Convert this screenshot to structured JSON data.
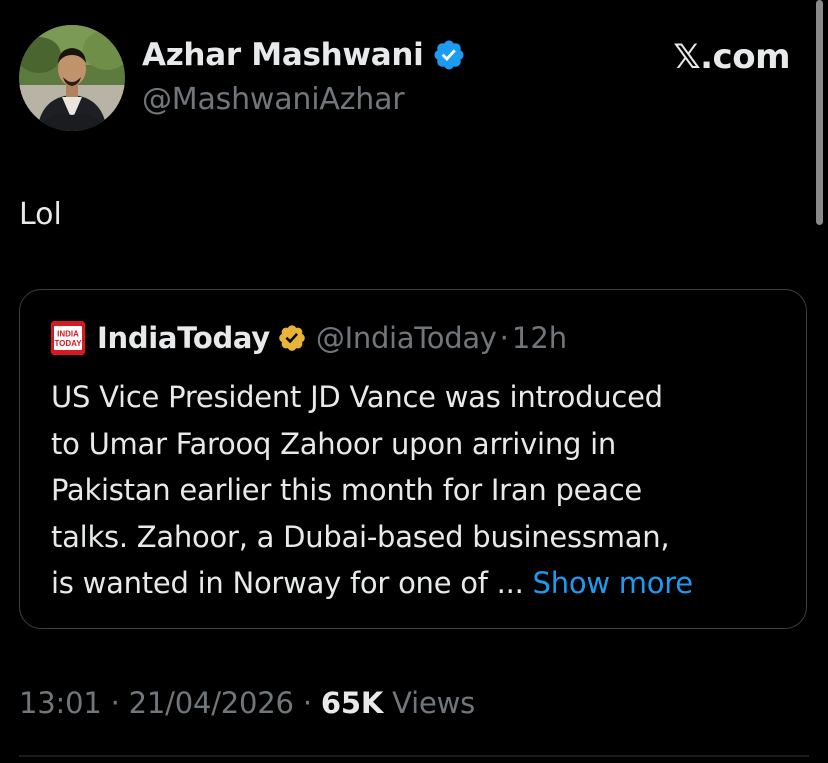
{
  "source": {
    "logo_text": "𝕏.com"
  },
  "author": {
    "name": "Azhar Mashwani",
    "handle": "@MashwaniAzhar",
    "verified": true,
    "badge_color": "#1d9bf0"
  },
  "tweet": {
    "text": "Lol"
  },
  "quote": {
    "logo_text_top": "INDIA",
    "logo_text_bottom": "TODAY",
    "name": "IndiaToday",
    "badge_color": "#e8b339",
    "handle": "@IndiaToday",
    "separator": "·",
    "time": "12h",
    "lines": [
      "US Vice President JD Vance was introduced",
      "to Umar Farooq Zahoor upon arriving in",
      "Pakistan earlier this month for Iran peace",
      "talks. Zahoor, a Dubai-based businessman,",
      "is wanted in Norway for one of ... "
    ],
    "show_more": "Show more"
  },
  "meta": {
    "time": "13:01",
    "sep1": " · ",
    "date": "21/04/2026",
    "sep2": " · ",
    "views_count": "65K",
    "views_label": " Views"
  },
  "colors": {
    "background": "#000000",
    "text": "#e7e9ea",
    "secondary": "#71767b",
    "link": "#1d9bf0",
    "border": "#3b3e42"
  }
}
